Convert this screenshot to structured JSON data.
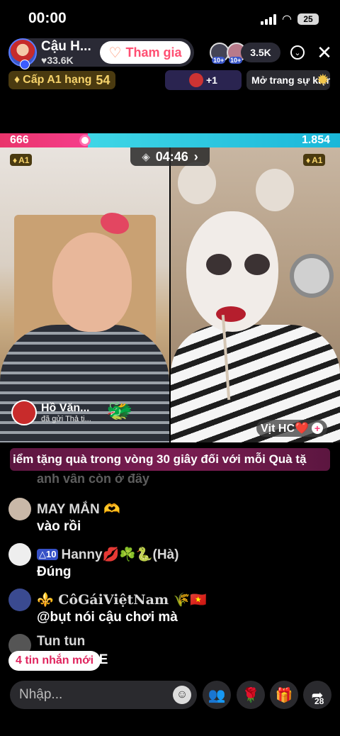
{
  "status": {
    "time": "00:00",
    "battery": "25"
  },
  "header": {
    "host_name": "Cậu H...",
    "host_likes": "♥33.6K",
    "join_label": "Tham gia",
    "viewer_badges": [
      "10+",
      "10+"
    ],
    "viewer_count": "3.5K"
  },
  "badges": {
    "level_text": "Cấp A1 hạng",
    "level_rank": "54",
    "gift_plus": "+1",
    "event_label": "Mở trang sự kiện"
  },
  "pk": {
    "left_score": "666",
    "right_score": "1.854",
    "timer": "04:46",
    "left_badge": "A1",
    "right_badge": "A1"
  },
  "video": {
    "sender_name": "Hồ Văn...",
    "sender_sub": "đã gửi Thả ti...",
    "guest_name": "Vịt HC❤️"
  },
  "ticker": "iểm tặng quà trong vòng 30 giây đối với mỗi Quà tặ",
  "chat": {
    "ghost": "anh vẫn còn ở đây",
    "messages": [
      {
        "name": "MAY MẮN 🫶",
        "text": "vào rồi",
        "level": ""
      },
      {
        "name": "Hanny💋☘️🐍(Hà)",
        "text": "Đúng",
        "level": "10"
      },
      {
        "name": "⚜️ CôGáiViệtNam 🌾🇻🇳",
        "text": "@bụt nói cậu chơi mà",
        "level": ""
      },
      {
        "name": "Tun tun",
        "text": "",
        "level": ""
      }
    ],
    "new_messages": "4 tin nhắn mới",
    "tail_text": "AE"
  },
  "bottom": {
    "input_placeholder": "Nhập...",
    "share_count": "28"
  },
  "colors": {
    "join_text": "#ff4f72",
    "pk_left": "#e9356b",
    "pk_right": "#1ab7d9",
    "gold": "#f6d36b"
  }
}
